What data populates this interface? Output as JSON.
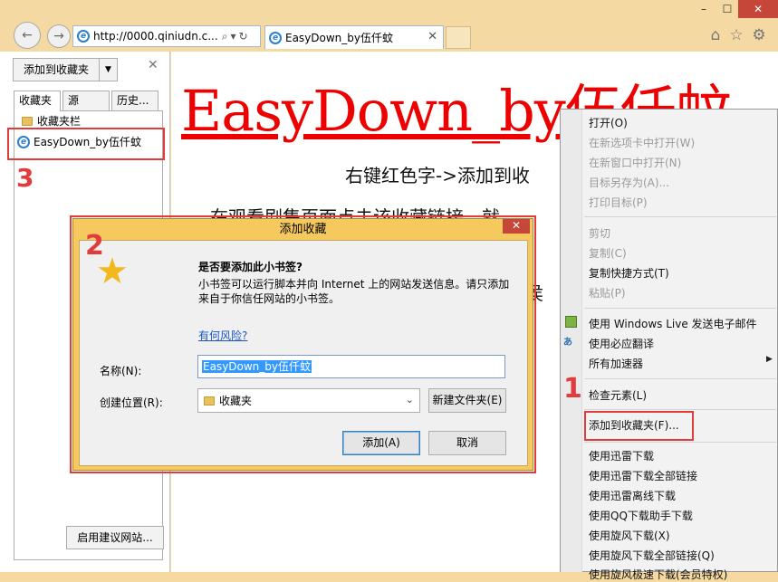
{
  "window": {
    "min": "–",
    "max": "☐",
    "close": "✕"
  },
  "nav": {
    "back_glyph": "←",
    "forward_glyph": "→"
  },
  "address": {
    "url": "http://0000.qiniudn.c...",
    "search_glyph": "⌕",
    "dropdown_glyph": "▾",
    "refresh_glyph": "↻"
  },
  "tab": {
    "title": "EasyDown_by伍仟蚊",
    "close": "✕"
  },
  "toolbar_icons": {
    "home": "⌂",
    "favorites": "☆",
    "tools": "⚙"
  },
  "favorites_pane": {
    "add_button": "添加到收藏夹",
    "add_dropdown": "▼",
    "close": "✕",
    "tabs": [
      "收藏夹",
      "源",
      "历史..."
    ],
    "folder": "收藏夹栏",
    "item": "EasyDown_by伍仟蚊",
    "suggest_button": "启用建议网站...",
    "step_number": "3"
  },
  "content": {
    "headline": "EasyDown_by伍仟蚊",
    "line1": "右键红色字->添加到收",
    "line2": "在观看剧集页面点击该收藏链接，就",
    "line3": "不侯"
  },
  "context_menu": {
    "step_number": "1",
    "items": [
      {
        "label": "打开(O)",
        "disabled": false
      },
      {
        "label": "在新选项卡中打开(W)",
        "disabled": true
      },
      {
        "label": "在新窗口中打开(N)",
        "disabled": true
      },
      {
        "label": "目标另存为(A)...",
        "disabled": true
      },
      {
        "label": "打印目标(P)",
        "disabled": true
      },
      {
        "label": "剪切",
        "disabled": true
      },
      {
        "label": "复制(C)",
        "disabled": true
      },
      {
        "label": "复制快捷方式(T)",
        "disabled": false
      },
      {
        "label": "粘贴(P)",
        "disabled": true
      },
      {
        "label": "使用 Windows Live 发送电子邮件",
        "disabled": false
      },
      {
        "label": "使用必应翻译",
        "disabled": false
      },
      {
        "label": "所有加速器",
        "disabled": false
      },
      {
        "label": "检查元素(L)",
        "disabled": false
      },
      {
        "label": "添加到收藏夹(F)...",
        "disabled": false
      },
      {
        "label": "使用迅雷下载",
        "disabled": false
      },
      {
        "label": "使用迅雷下载全部链接",
        "disabled": false
      },
      {
        "label": "使用迅雷离线下载",
        "disabled": false
      },
      {
        "label": "使用QQ下载助手下载",
        "disabled": false
      },
      {
        "label": "使用旋风下载(X)",
        "disabled": false
      },
      {
        "label": "使用旋风下载全部链接(Q)",
        "disabled": false
      },
      {
        "label": "使用旋风极速下载(会员特权)",
        "disabled": false
      }
    ],
    "submenu_arrow": "▶"
  },
  "dialog": {
    "step_number": "2",
    "title": "添加收藏",
    "close": "✕",
    "question": "是否要添加此小书签?",
    "description": "小书签可以运行脚本并向 Internet 上的网站发送信息。请只添加来自于你信任网站的小书签。",
    "risk_link": "有何风险?",
    "name_label": "名称(N):",
    "name_value": "EasyDown_by伍仟蚊",
    "location_label": "创建位置(R):",
    "location_value": "收藏夹",
    "location_chevron": "⌄",
    "new_folder_button": "新建文件夹(E)",
    "add_button": "添加(A)",
    "cancel_button": "取消",
    "star_glyph": "★"
  }
}
